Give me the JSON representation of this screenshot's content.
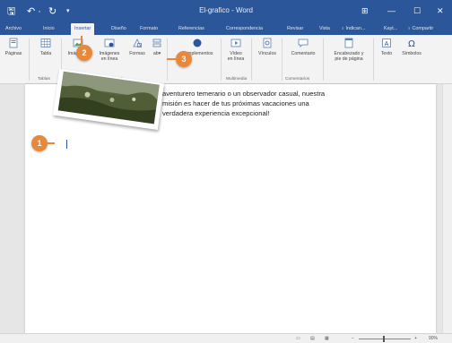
{
  "window": {
    "title": "El-grafico - Word",
    "qa_save": "🖫",
    "qa_undo": "↶ ·",
    "qa_redo": "↻",
    "qa_more": "▾",
    "ribbon_display": "⊞",
    "minimize": "—",
    "maximize": "☐",
    "close": "✕"
  },
  "tabs": [
    {
      "label": "Archivo"
    },
    {
      "label": "Inicio"
    },
    {
      "label": "Insertar"
    },
    {
      "label": "Diseño"
    },
    {
      "label": "Formato"
    },
    {
      "label": "Referencias"
    },
    {
      "label": "Correspondencia"
    },
    {
      "label": "Revisar"
    },
    {
      "label": "Vista"
    }
  ],
  "tell_me": "♀ Indican...",
  "user": "Kayt...",
  "share": "♀ Compartir",
  "ribbon": {
    "pages": "Páginas",
    "table": "Tabla",
    "images": "Imágenes",
    "online_images_1": "Imágenes",
    "online_images_2": "en línea",
    "shapes": "Formas",
    "smartart": "ab▾",
    "complements": "Complementos",
    "online_video_1": "Vídeo",
    "online_video_2": "en línea",
    "links": "Vínculos",
    "comment": "Comentario",
    "header_footer_1": "Encabezado y",
    "header_footer_2": "pie de página",
    "text": "Texto",
    "symbols": "Símbolos",
    "groups": {
      "tables": "Tablas",
      "illustrations": "Ilustraciones",
      "multimedia": "Multimedia",
      "comments": "Comentarios"
    }
  },
  "document": {
    "line1": "aventurero temerario o un observador casual, nuestra",
    "line2": "misión es hacer de tus próximas vacaciones una",
    "line3": "verdadera experiencia excepcional!"
  },
  "callouts": {
    "one": "1",
    "two": "2",
    "three": "3"
  },
  "status": {
    "zoom": "90%",
    "minus": "−",
    "plus": "+"
  },
  "colors": {
    "accent": "#2b579a",
    "callout": "#e8883a"
  }
}
